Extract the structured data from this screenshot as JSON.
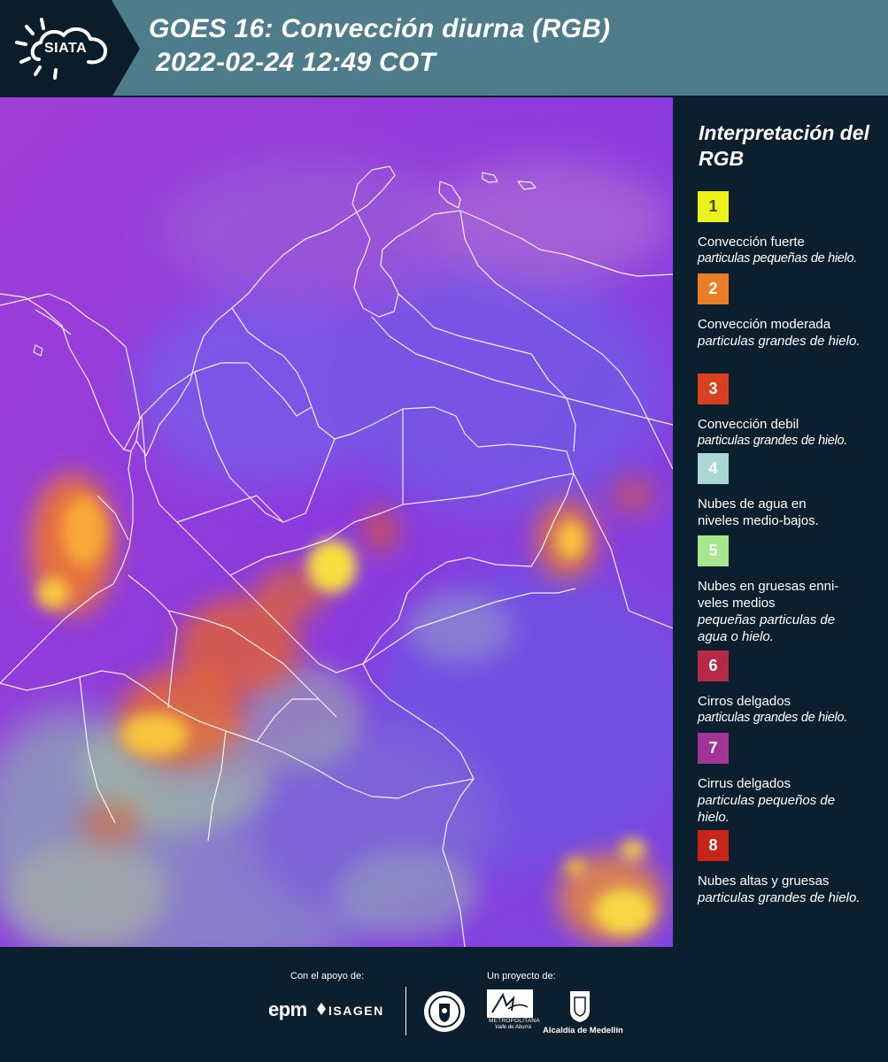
{
  "header": {
    "logo_text": "SIATA",
    "title_line1": "GOES 16: Convección diurna (RGB)",
    "title_line2": "2022-02-24 12:49 COT",
    "band_color": "#4e7c8a"
  },
  "legend": {
    "title": "Interpretación del RGB",
    "items": [
      {
        "number": "1",
        "color": "#eef21c",
        "text_color": "#4a4a10",
        "name": "Convección fuerte",
        "description": "particulas pequeñas de hielo."
      },
      {
        "number": "2",
        "color": "#ea7d26",
        "text_color": "#ffffff",
        "name": "Convección moderada",
        "description": "particulas grandes de hielo."
      },
      {
        "number": "3",
        "color": "#d8401f",
        "text_color": "#ffffff",
        "name": "Convección debil",
        "description": "particulas grandes de hielo."
      },
      {
        "number": "4",
        "color": "#a9d7d3",
        "text_color": "#ffffff",
        "name": "Nubes de agua en niveles medio-bajos.",
        "description": ""
      },
      {
        "number": "5",
        "color": "#a8e58f",
        "text_color": "#ffffff",
        "name": "Nubes en gruesas enni-veles medios",
        "description": "pequeñas particulas de agua o hielo."
      },
      {
        "number": "6",
        "color": "#b62a48",
        "text_color": "#ffffff",
        "name": "Cirros delgados",
        "description": "particulas grandes de hielo."
      },
      {
        "number": "7",
        "color": "#a33497",
        "text_color": "#ffffff",
        "name": "Cirrus delgados",
        "description": "particulas pequeños de hielo."
      },
      {
        "number": "8",
        "color": "#c62518",
        "text_color": "#ffffff",
        "name": "Nubes altas y gruesas",
        "description": "particulas grandes de hielo."
      }
    ]
  },
  "footer": {
    "support_label": "Con el apoyo de:",
    "project_label": "Un proyecto de:",
    "support_logos": [
      "epm",
      "ISAGEN"
    ],
    "project_logos": {
      "area_label": "METROPOLITANA",
      "area_sub": "Valle de Aburrá",
      "alcaldia": "Alcaldía de Medellín"
    }
  },
  "map": {
    "background_color": "#8a3ad4",
    "border_color": "#ffffff"
  }
}
